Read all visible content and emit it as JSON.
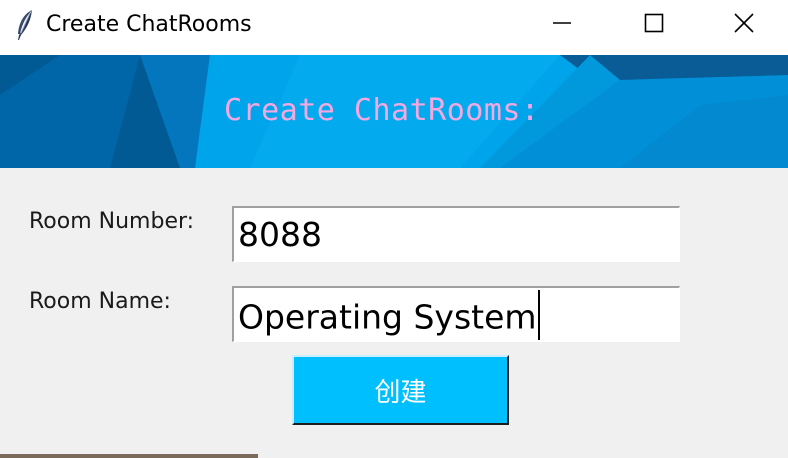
{
  "window": {
    "title": "Create ChatRooms",
    "icon": "feather-icon",
    "controls": [
      "minimize-icon",
      "maximize-icon",
      "close-icon"
    ]
  },
  "banner": {
    "title": "Create ChatRooms:",
    "title_color": "#f4a8e0",
    "colors": [
      "#0287d0",
      "#00a2e8",
      "#0a5a96",
      "#015c99",
      "#0068ad"
    ]
  },
  "form": {
    "room_number": {
      "label": "Room Number:",
      "value": "8088"
    },
    "room_name": {
      "label": "Room Name:",
      "value": "Operating System"
    },
    "create_button": {
      "label": "创建",
      "color": "#00bfff"
    }
  }
}
